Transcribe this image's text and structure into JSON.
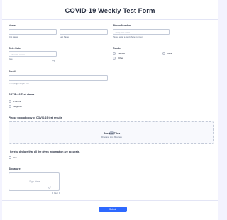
{
  "form": {
    "title": "COVID-19 Weekly Test Form",
    "name": {
      "label": "Name",
      "first_sub": "First Name",
      "last_sub": "Last Name"
    },
    "phone": {
      "label": "Phone Number",
      "placeholder": "(000) 000-0000",
      "sub": "Please enter a valid phone number."
    },
    "birth_date": {
      "label": "Birth Date",
      "placeholder": "MM-DD-YYYY",
      "sub": "Date",
      "icon": "calendar-icon"
    },
    "gender": {
      "label": "Gender",
      "options": [
        "Female",
        "Male",
        "Other"
      ]
    },
    "email": {
      "label": "Email",
      "sub": "example@example.com"
    },
    "test_status": {
      "label": "COVID-19 Test status",
      "options": [
        "Positive",
        "Negative"
      ]
    },
    "upload": {
      "label": "Please upload copy of COVID-19 test results",
      "button": "Browse Files",
      "hint": "Drag and drop files here",
      "icon": "cloud-upload-icon"
    },
    "declaration": {
      "label": "I hereby declare that all the given information are accurate.",
      "option": "Yes"
    },
    "signature": {
      "label": "Signature",
      "placeholder": "Sign Here",
      "clear": "Clear",
      "icon": "pen-icon"
    },
    "submit": "Submit",
    "colors": {
      "accent": "#2e69ff",
      "background": "#f3f3fe",
      "border": "#c3cad8"
    }
  }
}
